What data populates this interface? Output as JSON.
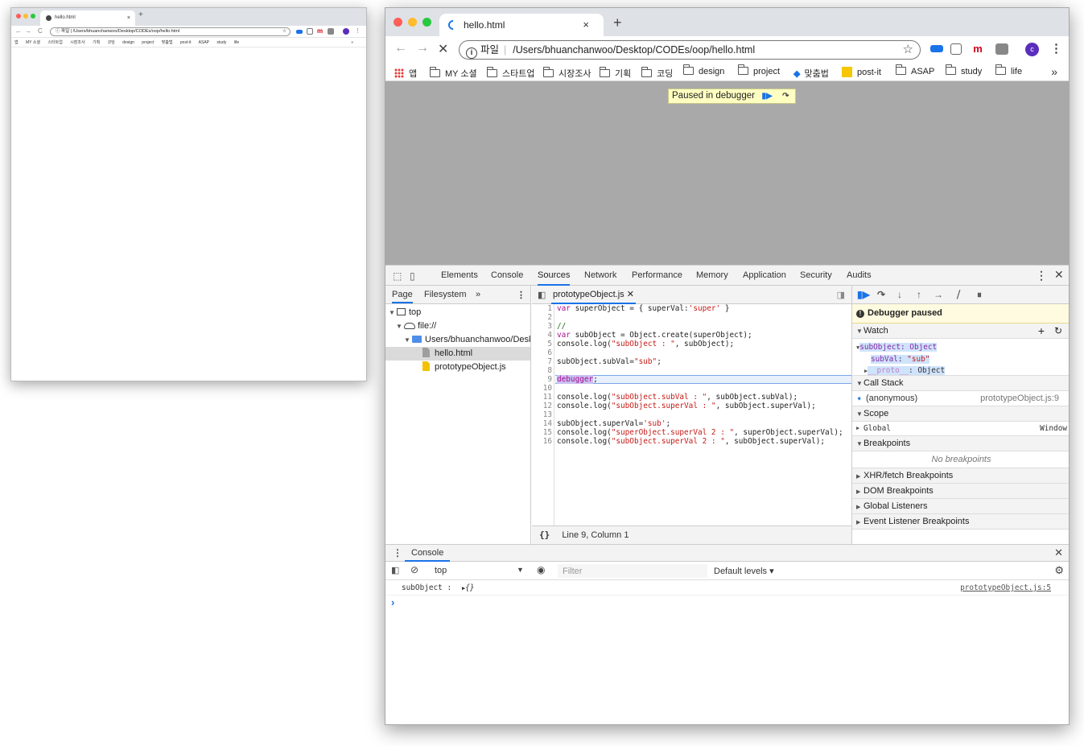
{
  "small_window": {
    "tab_title": "hello.html",
    "url_scheme": "파일",
    "url": "/Users/bhuanchanwoo/Desktop/CODEs/oop/hello.html",
    "bookmarks": [
      "앱",
      "MY 소셜",
      "스타트업",
      "시장조사",
      "기획",
      "코딩",
      "design",
      "project",
      "맞춤법",
      "post-it",
      "ASAP",
      "study",
      "life"
    ],
    "more": "»"
  },
  "browser": {
    "tab_title": "hello.html",
    "tab_close": "×",
    "new_tab": "+",
    "url_scheme": "파일",
    "url": "/Users/bhuanchanwoo/Desktop/CODEs/oop/hello.html",
    "avatar": "c",
    "ext_m": "m",
    "bookmarks": {
      "apps": "앱",
      "items": [
        "MY 소셜",
        "스타트업",
        "시장조사",
        "기획",
        "코딩",
        "design",
        "project",
        "맞춤법",
        "post-it",
        "ASAP",
        "study",
        "life"
      ],
      "more": "»"
    }
  },
  "viewport": {
    "paused_label": "Paused in debugger"
  },
  "devtools": {
    "tabs": [
      "Elements",
      "Console",
      "Sources",
      "Network",
      "Performance",
      "Memory",
      "Application",
      "Security",
      "Audits"
    ],
    "active_tab": "Sources",
    "navigator": {
      "tabs": [
        "Page",
        "Filesystem"
      ],
      "more": "»",
      "tree": {
        "top": "top",
        "origin": "file://",
        "folder": "Users/bhuanchanwoo/Deskt",
        "files": [
          "hello.html",
          "prototypeObject.js"
        ]
      }
    },
    "editor": {
      "file_tab": "prototypeObject.js",
      "current_line": 9,
      "status": "Line 9, Column 1",
      "format_icon": "{}"
    },
    "sidebar": {
      "debugger_paused": "Debugger paused",
      "watch_header": "Watch",
      "watch": {
        "expr": "subObject: Object",
        "prop_key": "subVal",
        "prop_value": "\"sub\"",
        "proto_key": "__proto__",
        "proto_value": "Object"
      },
      "call_stack_header": "Call Stack",
      "call_stack": {
        "fn": "(anonymous)",
        "loc": "prototypeObject.js:9"
      },
      "scope_header": "Scope",
      "scope": {
        "name": "Global",
        "value": "Window"
      },
      "breakpoints_header": "Breakpoints",
      "no_breakpoints": "No breakpoints",
      "xhr": "XHR/fetch Breakpoints",
      "dom": "DOM Breakpoints",
      "global_listeners": "Global Listeners",
      "event_listeners": "Event Listener Breakpoints"
    },
    "console": {
      "drawer_tab": "Console",
      "context": "top",
      "filter_placeholder": "Filter",
      "levels": "Default levels ▾",
      "log_text": "subObject :",
      "log_value": "{}",
      "log_source": "prototypeObject.js:5",
      "prompt": "›"
    }
  },
  "colors": {
    "accent": "#1a73e8",
    "paused_bg": "#ffffc2",
    "viewport_bg": "#a9a9a9",
    "keyword": "#aa0d91",
    "string": "#c41a16"
  }
}
